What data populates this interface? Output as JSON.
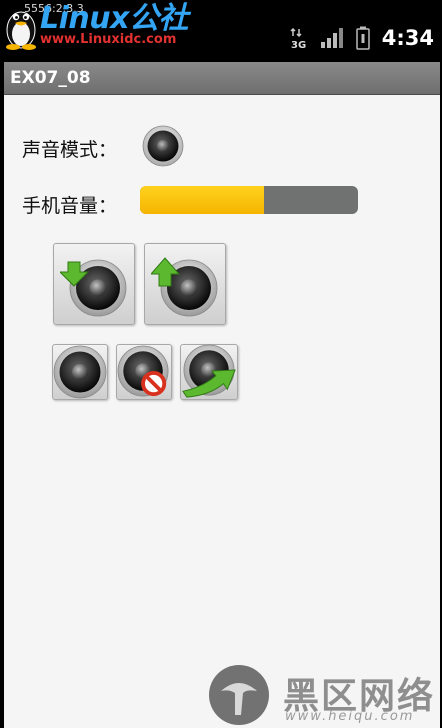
{
  "status_bar": {
    "emulator_label": "5556:2.3.3",
    "network_type": "3G",
    "time": "4:34"
  },
  "watermark_top": {
    "brand": "Linux公社",
    "url": "www.Linuxidc.com"
  },
  "app": {
    "title": "EX07_08"
  },
  "sound_mode": {
    "label": "声音模式：",
    "icon": "speaker-icon"
  },
  "phone_volume": {
    "label": "手机音量：",
    "level": 0.57,
    "fill_color": "#f7c000",
    "track_color": "#6f7270"
  },
  "buttons": [
    {
      "name": "volume-down-button",
      "icon": "speaker-arrow-down-icon"
    },
    {
      "name": "volume-up-button",
      "icon": "speaker-arrow-up-icon"
    },
    {
      "name": "normal-mode-button",
      "icon": "speaker-icon"
    },
    {
      "name": "silent-mode-button",
      "icon": "speaker-mute-icon"
    },
    {
      "name": "vibrate-mode-button",
      "icon": "speaker-arrow-right-icon"
    }
  ],
  "watermark_bottom": {
    "brand": "黑区网络",
    "url": "www.heiqu.com"
  }
}
